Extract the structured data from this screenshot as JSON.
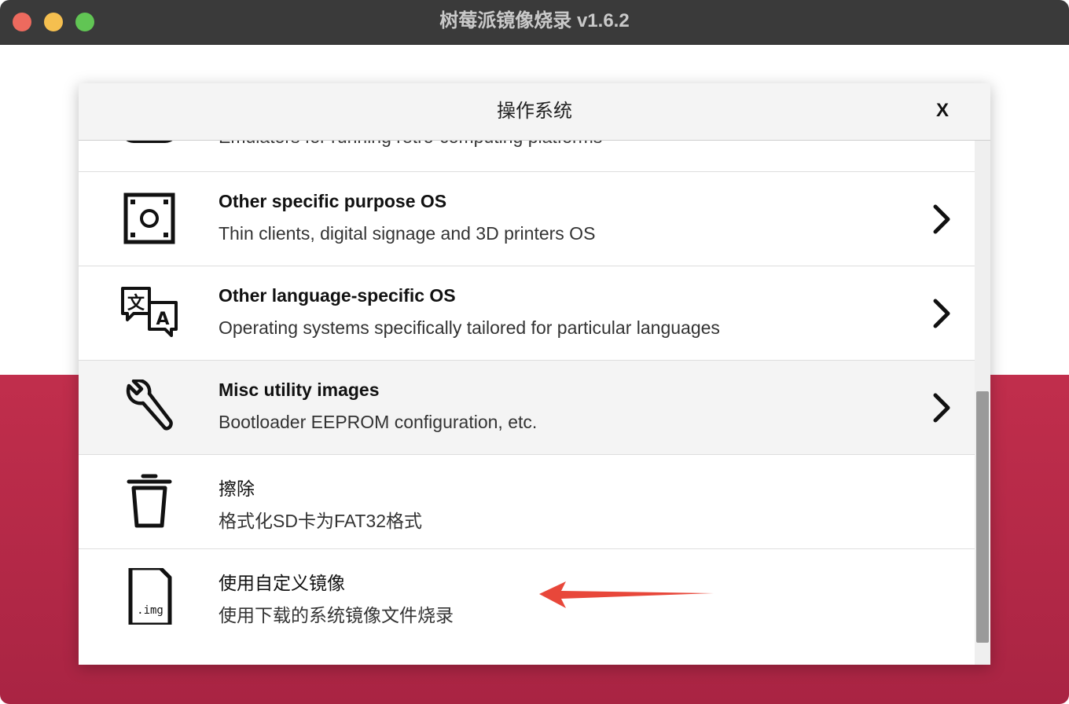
{
  "window": {
    "title": "树莓派镜像烧录 v1.6.2",
    "colors": {
      "titlebar": "#3a3a3a",
      "accent": "#c12e4c",
      "annotation_arrow": "#e8473a"
    }
  },
  "dialog": {
    "title": "操作系统",
    "close_label": "X",
    "items": [
      {
        "title": "",
        "desc": "Emulators for running retro-computing platforms",
        "icon": "gamepad-icon",
        "has_chevron": true
      },
      {
        "title": "Other specific purpose OS",
        "desc": "Thin clients, digital signage and 3D printers OS",
        "icon": "device-box-icon",
        "has_chevron": true
      },
      {
        "title": "Other language-specific OS",
        "desc": "Operating systems specifically tailored for particular languages",
        "icon": "translate-icon",
        "has_chevron": true
      },
      {
        "title": "Misc utility images",
        "desc": "Bootloader EEPROM configuration, etc.",
        "icon": "wrench-icon",
        "has_chevron": true,
        "highlighted": true
      },
      {
        "title": "擦除",
        "desc": "格式化SD卡为FAT32格式",
        "icon": "trash-icon",
        "has_chevron": false
      },
      {
        "title": "使用自定义镜像",
        "desc": "使用下载的系统镜像文件烧录",
        "icon": "img-file-icon",
        "icon_label": ".img",
        "has_chevron": false
      }
    ]
  }
}
